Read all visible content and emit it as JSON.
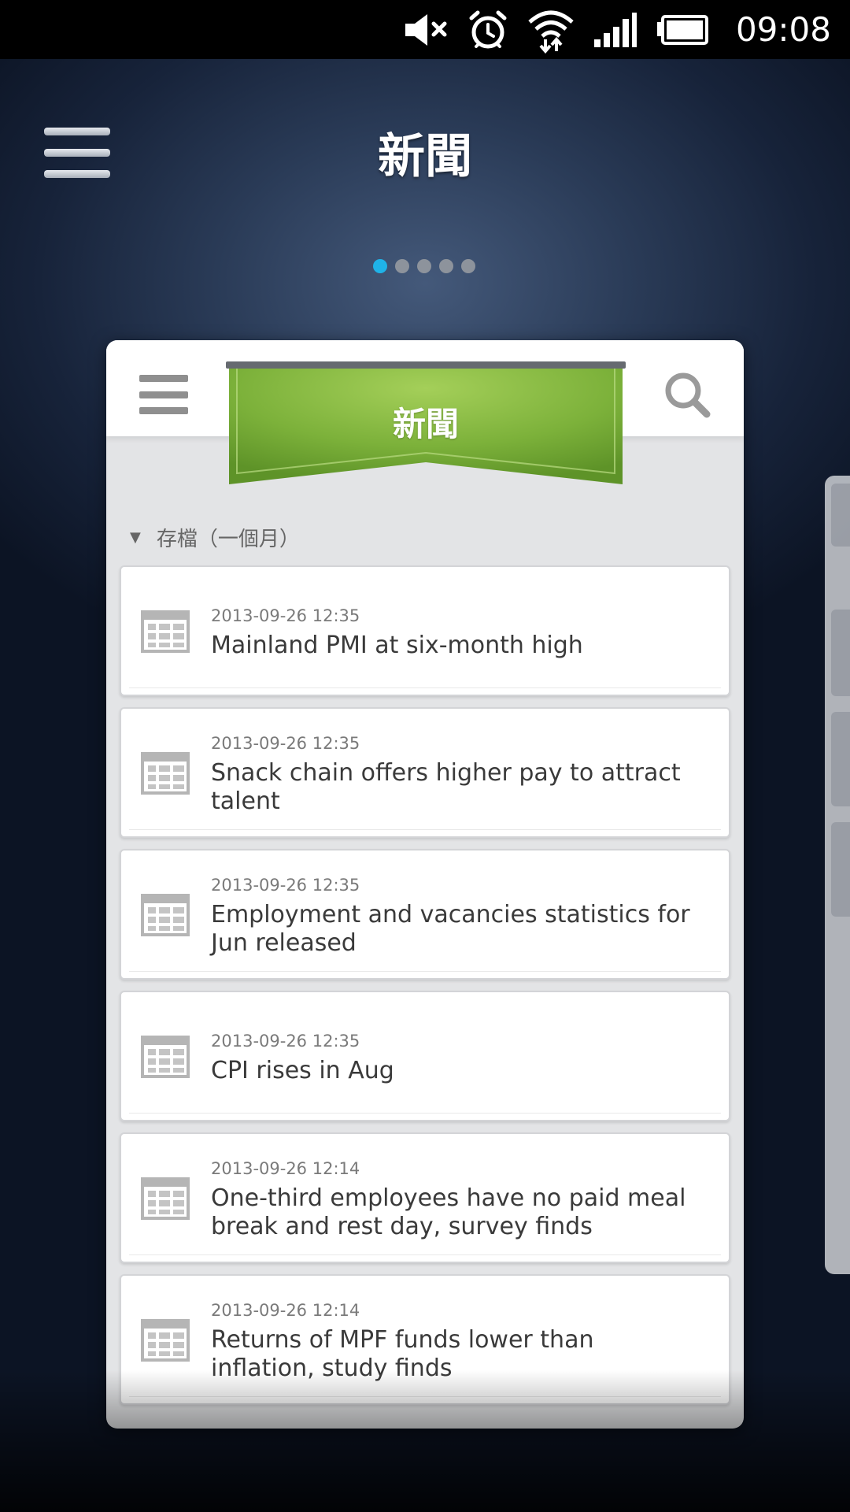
{
  "status_bar": {
    "time": "09:08",
    "icons": [
      "mute-icon",
      "alarm-icon",
      "wifi-icon",
      "signal-icon",
      "battery-icon"
    ]
  },
  "header": {
    "title": "新聞",
    "pager": {
      "count": 5,
      "active_index": 0
    }
  },
  "widget": {
    "ribbon_label": "新聞",
    "ribbon_color": "#7cb13a",
    "archive_label": "存檔（一個月）",
    "news": [
      {
        "date": "2013-09-26 12:35",
        "title": "Mainland PMI at six-month high"
      },
      {
        "date": "2013-09-26 12:35",
        "title": "Snack chain offers higher pay to attract talent"
      },
      {
        "date": "2013-09-26 12:35",
        "title": "Employment and vacancies statistics for Jun released"
      },
      {
        "date": "2013-09-26 12:35",
        "title": "CPI rises in Aug"
      },
      {
        "date": "2013-09-26 12:14",
        "title": "One-third employees have no paid meal break and rest day, survey finds"
      },
      {
        "date": "2013-09-26 12:14",
        "title": "Returns of MPF funds lower than inflation, study finds"
      }
    ]
  },
  "colors": {
    "accent_dot": "#1fb3e8",
    "background": "#1e2d47"
  }
}
